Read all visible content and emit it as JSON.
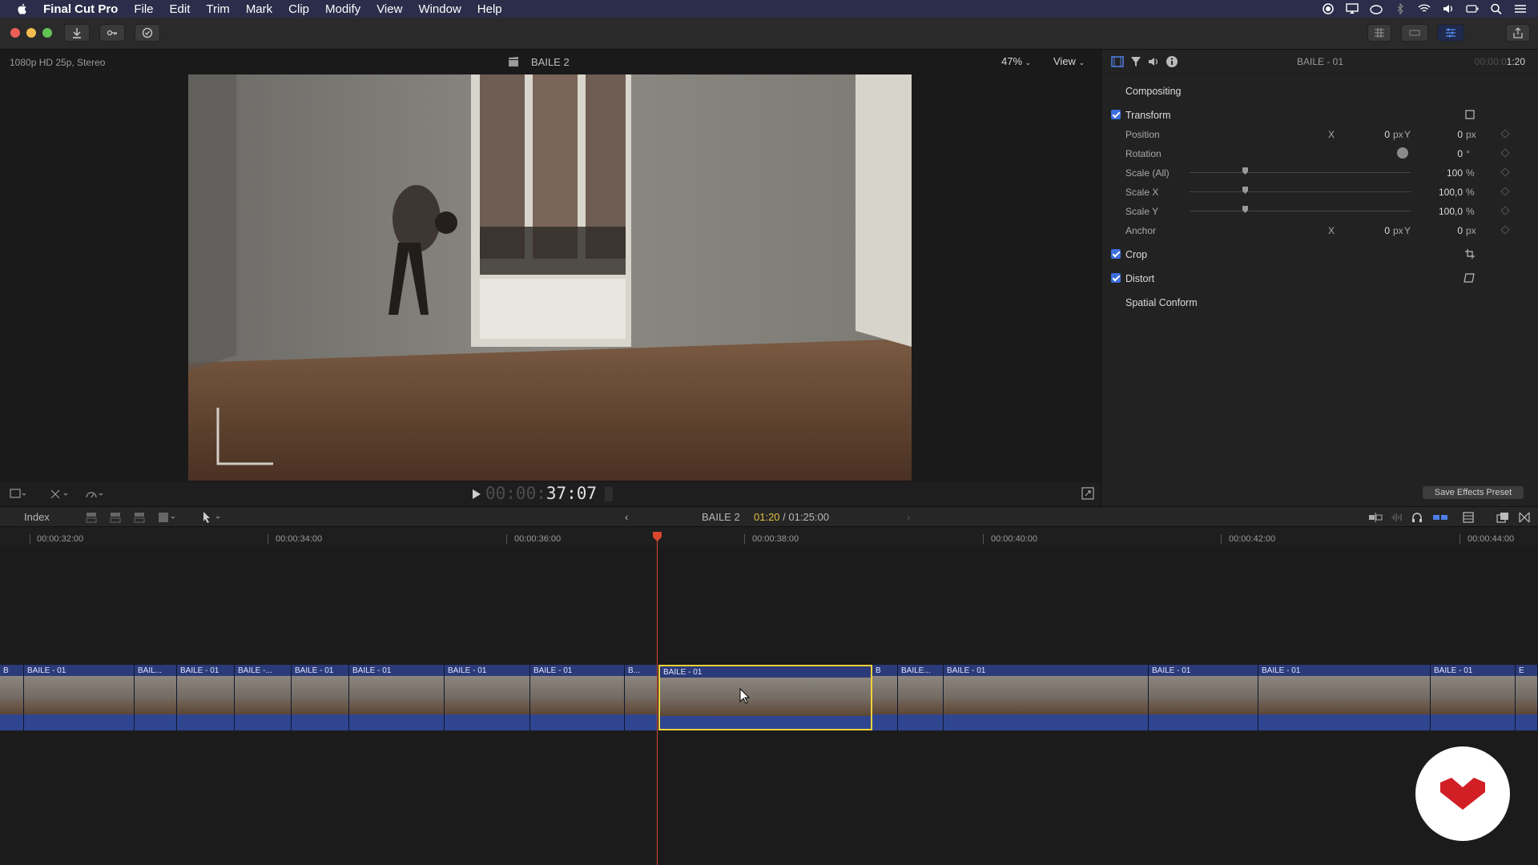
{
  "menubar": {
    "app_name": "Final Cut Pro",
    "items": [
      "File",
      "Edit",
      "Trim",
      "Mark",
      "Clip",
      "Modify",
      "View",
      "Window",
      "Help"
    ]
  },
  "viewer": {
    "format_info": "1080p HD 25p, Stereo",
    "project_name": "BAILE 2",
    "zoom_level": "47%",
    "view_menu": "View",
    "timecode_dim": "00:00:",
    "timecode_bright": "37:07"
  },
  "inspector": {
    "clip_name": "BAILE - 01",
    "duration_dim": "00:00:0",
    "duration_bright": "1:20",
    "compositing_label": "Compositing",
    "transform": {
      "label": "Transform",
      "position": {
        "label": "Position",
        "x_label": "X",
        "x_value": "0",
        "x_unit": "px",
        "y_label": "Y",
        "y_value": "0",
        "y_unit": "px"
      },
      "rotation": {
        "label": "Rotation",
        "value": "0",
        "unit": "°"
      },
      "scale_all": {
        "label": "Scale (All)",
        "value": "100",
        "unit": "%"
      },
      "scale_x": {
        "label": "Scale X",
        "value": "100,0",
        "unit": "%"
      },
      "scale_y": {
        "label": "Scale Y",
        "value": "100,0",
        "unit": "%"
      },
      "anchor": {
        "label": "Anchor",
        "x_label": "X",
        "x_value": "0",
        "x_unit": "px",
        "y_label": "Y",
        "y_value": "0",
        "y_unit": "px"
      }
    },
    "crop_label": "Crop",
    "distort_label": "Distort",
    "spatial_conform_label": "Spatial Conform",
    "save_preset_label": "Save Effects Preset"
  },
  "timeline": {
    "index_label": "Index",
    "project_name": "BAILE 2",
    "position_current": "01:20",
    "position_total": "/ 01:25:00",
    "ruler": [
      "00:00:32:00",
      "00:00:34:00",
      "00:00:36:00",
      "00:00:38:00",
      "00:00:40:00",
      "00:00:42:00",
      "00:00:44:00"
    ],
    "clips": [
      {
        "label": "B"
      },
      {
        "label": "BAILE - 01"
      },
      {
        "label": "BAIL..."
      },
      {
        "label": "BAILE - 01"
      },
      {
        "label": "BAILE -..."
      },
      {
        "label": "BAILE - 01"
      },
      {
        "label": "BAILE - 01"
      },
      {
        "label": "BAILE - 01"
      },
      {
        "label": "BAILE - 01"
      },
      {
        "label": "B..."
      },
      {
        "label": "BAILE - 01",
        "selected": true
      },
      {
        "label": "B"
      },
      {
        "label": "BAILE..."
      },
      {
        "label": "BAILE - 01"
      },
      {
        "label": "BAILE - 01"
      },
      {
        "label": "BAILE - 01"
      },
      {
        "label": "BAILE - 01"
      },
      {
        "label": "E"
      }
    ]
  },
  "colors": {
    "accent_blue": "#3c6ee0",
    "clip_blue": "#2b3a78",
    "selection_yellow": "#f2d23a",
    "playhead_red": "#d9482e",
    "logo_red": "#d21f26"
  }
}
